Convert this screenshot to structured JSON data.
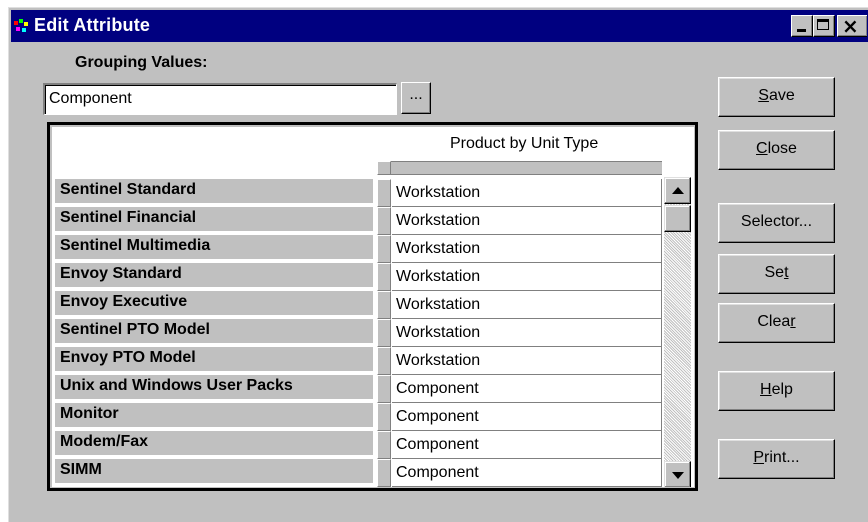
{
  "window": {
    "title": "Edit Attribute",
    "app_icon": "app-icon",
    "controls": {
      "minimize": "minimize-icon",
      "maximize": "maximize-icon",
      "close": "close-icon"
    }
  },
  "grouping": {
    "label": "Grouping Values:",
    "value": "Component",
    "browse_label": "..."
  },
  "grid": {
    "column_header": "Product by Unit Type",
    "rows": [
      {
        "label": "Sentinel Standard",
        "value": "Workstation"
      },
      {
        "label": "Sentinel Financial",
        "value": "Workstation"
      },
      {
        "label": "Sentinel Multimedia",
        "value": "Workstation"
      },
      {
        "label": "Envoy Standard",
        "value": "Workstation"
      },
      {
        "label": "Envoy Executive",
        "value": "Workstation"
      },
      {
        "label": "Sentinel PTO Model",
        "value": "Workstation"
      },
      {
        "label": "Envoy PTO Model",
        "value": "Workstation"
      },
      {
        "label": "Unix and Windows User Packs",
        "value": "Component"
      },
      {
        "label": "Monitor",
        "value": "Component"
      },
      {
        "label": "Modem/Fax",
        "value": "Component"
      },
      {
        "label": "SIMM",
        "value": "Component"
      }
    ]
  },
  "buttons": {
    "save": {
      "pre": "",
      "key": "S",
      "post": "ave"
    },
    "close": {
      "pre": "",
      "key": "C",
      "post": "lose"
    },
    "selector": {
      "pre": "Selector...",
      "key": "",
      "post": ""
    },
    "set": {
      "pre": "Se",
      "key": "t",
      "post": ""
    },
    "clear": {
      "pre": "Clea",
      "key": "r",
      "post": ""
    },
    "help": {
      "pre": "",
      "key": "H",
      "post": "elp"
    },
    "print": {
      "pre": "",
      "key": "P",
      "post": "rint..."
    }
  },
  "colors": {
    "title_bar": "#000080",
    "face": "#c0c0c0",
    "window_bg": "#ffffff"
  }
}
